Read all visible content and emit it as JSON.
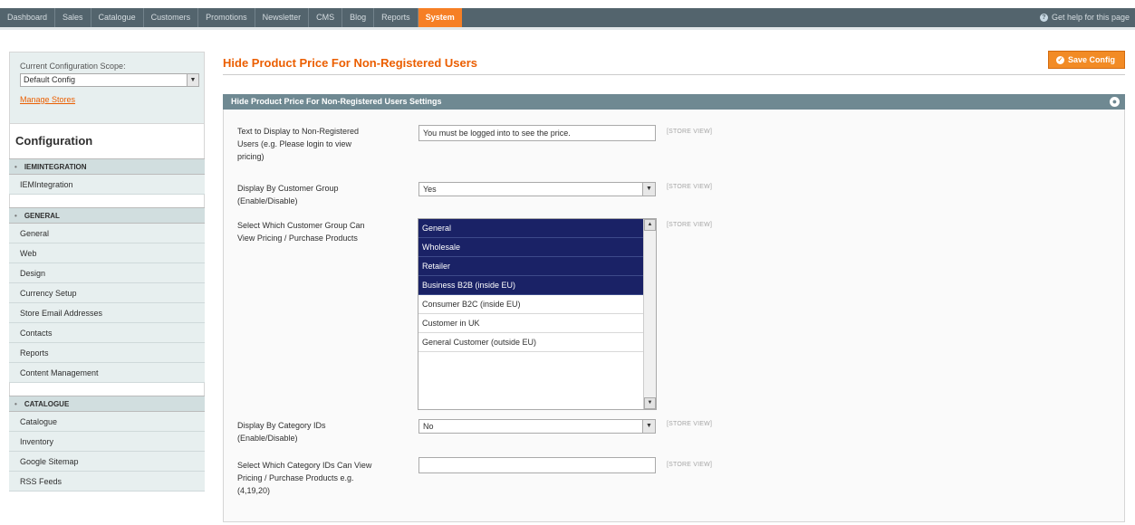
{
  "topnav": {
    "items": [
      "Dashboard",
      "Sales",
      "Catalogue",
      "Customers",
      "Promotions",
      "Newsletter",
      "CMS",
      "Blog",
      "Reports",
      "System"
    ],
    "active_index": 9,
    "help": "Get help for this page"
  },
  "sidebar": {
    "scope_label": "Current Configuration Scope:",
    "scope_value": "Default Config",
    "manage_stores": "Manage Stores",
    "config_title": "Configuration",
    "sections": [
      {
        "title": "IEMINTEGRATION",
        "items": [
          "IEMIntegration"
        ]
      },
      {
        "title": "GENERAL",
        "items": [
          "General",
          "Web",
          "Design",
          "Currency Setup",
          "Store Email Addresses",
          "Contacts",
          "Reports",
          "Content Management"
        ]
      },
      {
        "title": "CATALOGUE",
        "items": [
          "Catalogue",
          "Inventory",
          "Google Sitemap",
          "RSS Feeds"
        ]
      }
    ]
  },
  "main": {
    "page_title": "Hide Product Price For Non-Registered Users",
    "save_label": "Save Config",
    "fieldset_title": "Hide Product Price For Non-Registered Users Settings",
    "scope_tag": "[STORE VIEW]",
    "fields": {
      "text_label": "Text to Display to Non-Registered Users (e.g. Please login to view pricing)",
      "text_value": "You must be logged into to see the price.",
      "group_enable_label": "Display By Customer Group (Enable/Disable)",
      "group_enable_value": "Yes",
      "group_select_label": "Select Which Customer Group Can View Pricing / Purchase Products",
      "group_options": [
        {
          "label": "General",
          "selected": true
        },
        {
          "label": "Wholesale",
          "selected": true
        },
        {
          "label": "Retailer",
          "selected": true
        },
        {
          "label": "Business B2B (inside EU)",
          "selected": true
        },
        {
          "label": "Consumer B2C (inside EU)",
          "selected": false
        },
        {
          "label": "Customer in UK",
          "selected": false
        },
        {
          "label": "General Customer (outside EU)",
          "selected": false
        }
      ],
      "category_enable_label": "Display By Category IDs (Enable/Disable)",
      "category_enable_value": "No",
      "category_ids_label": "Select Which Category IDs Can View Pricing / Purchase Products e.g.(4,19,20)",
      "category_ids_value": ""
    }
  },
  "colors": {
    "accent": "#eb5e00",
    "nav_bg": "#53646d",
    "selected_option": "#1a2266"
  }
}
